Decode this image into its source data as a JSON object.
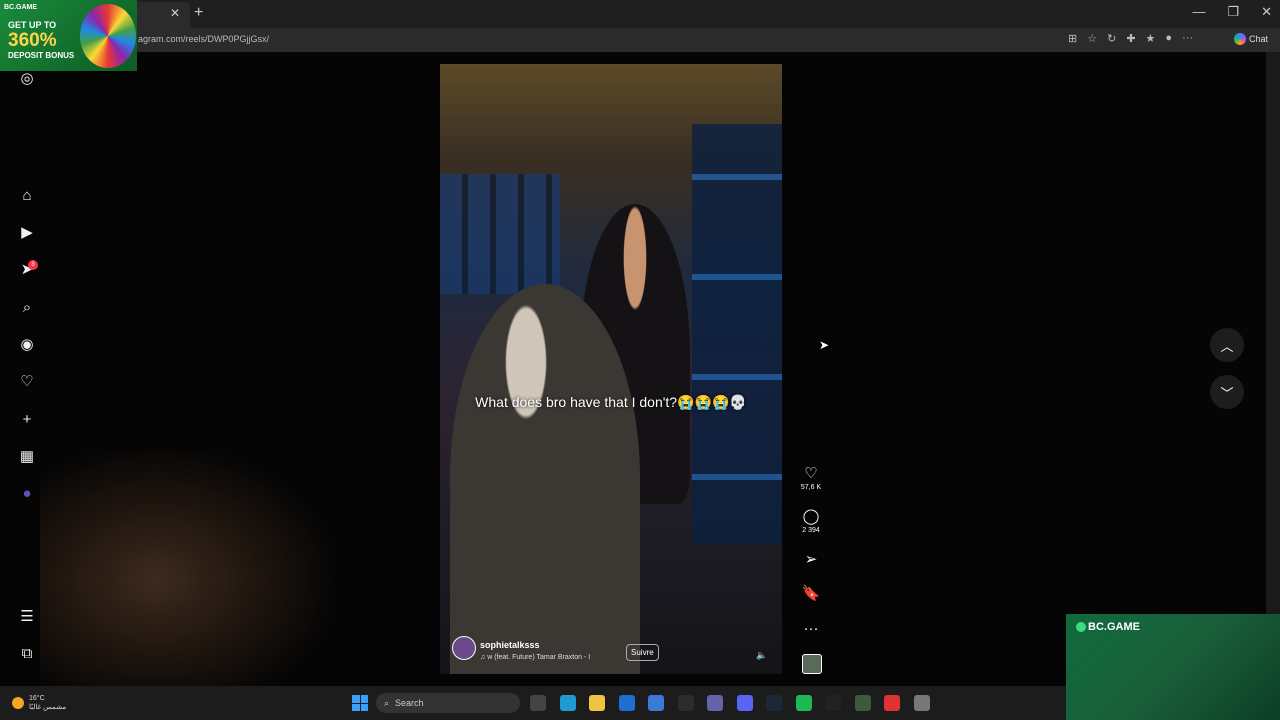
{
  "browser": {
    "url": "agram.com/reels/DWP0PGjjGsx/",
    "chat_label": "Chat",
    "tab_close": "✕",
    "new_tab": "+",
    "window_buttons": [
      "—",
      "❐",
      "✕"
    ]
  },
  "promo": {
    "brand": "BC.GAME",
    "line1": "GET UP TO",
    "line2": "360%",
    "line3": "DEPOSIT BONUS"
  },
  "sidebar": {
    "items": [
      {
        "name": "instagram-logo-icon",
        "glyph": "◎"
      },
      {
        "name": "home-icon",
        "glyph": "⌂"
      },
      {
        "name": "reels-icon",
        "glyph": "▶"
      },
      {
        "name": "messages-icon",
        "glyph": "➤"
      },
      {
        "name": "search-icon",
        "glyph": "⌕"
      },
      {
        "name": "explore-icon",
        "glyph": "◉"
      },
      {
        "name": "notifications-icon",
        "glyph": "♡"
      },
      {
        "name": "create-icon",
        "glyph": "+"
      },
      {
        "name": "dashboard-icon",
        "glyph": "▦"
      },
      {
        "name": "profile-icon",
        "glyph": "●"
      },
      {
        "name": "menu-icon",
        "glyph": "☰"
      },
      {
        "name": "also-from-meta-icon",
        "glyph": "⧉"
      }
    ],
    "messages_badge": "8"
  },
  "reel": {
    "caption": "What does bro have that I don't?😭😭😭💀",
    "username": "sophietalksss",
    "music": "♫  w (feat. Future)  Tamar Braxton - I",
    "follow_label": "Suivre",
    "mute_glyph": "🔈"
  },
  "actions": {
    "like_count": "57,6 K",
    "comment_count": "2 394",
    "like_glyph": "♡",
    "comment_glyph": "◯",
    "share_glyph": "➢",
    "save_glyph": "🔖",
    "more_glyph": "···"
  },
  "nav": {
    "up_glyph": "︿",
    "down_glyph": "﹀"
  },
  "bc_panel": {
    "label": "BC.GAME"
  },
  "taskbar": {
    "temperature": "16°C",
    "weather_text": "مشمس غالبًا",
    "search_placeholder": "Search",
    "apps": [
      {
        "name": "task-view-icon",
        "color": "#444"
      },
      {
        "name": "edge-icon",
        "color": "#1f9bd1"
      },
      {
        "name": "file-explorer-icon",
        "color": "#f0c340"
      },
      {
        "name": "outlook-icon",
        "color": "#1f6fd1"
      },
      {
        "name": "store-icon",
        "color": "#3a7bd5"
      },
      {
        "name": "obs-icon",
        "color": "#2b2b2b"
      },
      {
        "name": "teams-icon",
        "color": "#6264a7"
      },
      {
        "name": "discord-icon",
        "color": "#5865f2"
      },
      {
        "name": "steam-icon",
        "color": "#1b2838"
      },
      {
        "name": "spotify-icon",
        "color": "#1db954"
      },
      {
        "name": "g-hub-icon",
        "color": "#222"
      },
      {
        "name": "terminal-icon",
        "color": "#3b5b3b"
      },
      {
        "name": "app-red-icon",
        "color": "#d33"
      },
      {
        "name": "settings-icon",
        "color": "#777"
      }
    ]
  }
}
